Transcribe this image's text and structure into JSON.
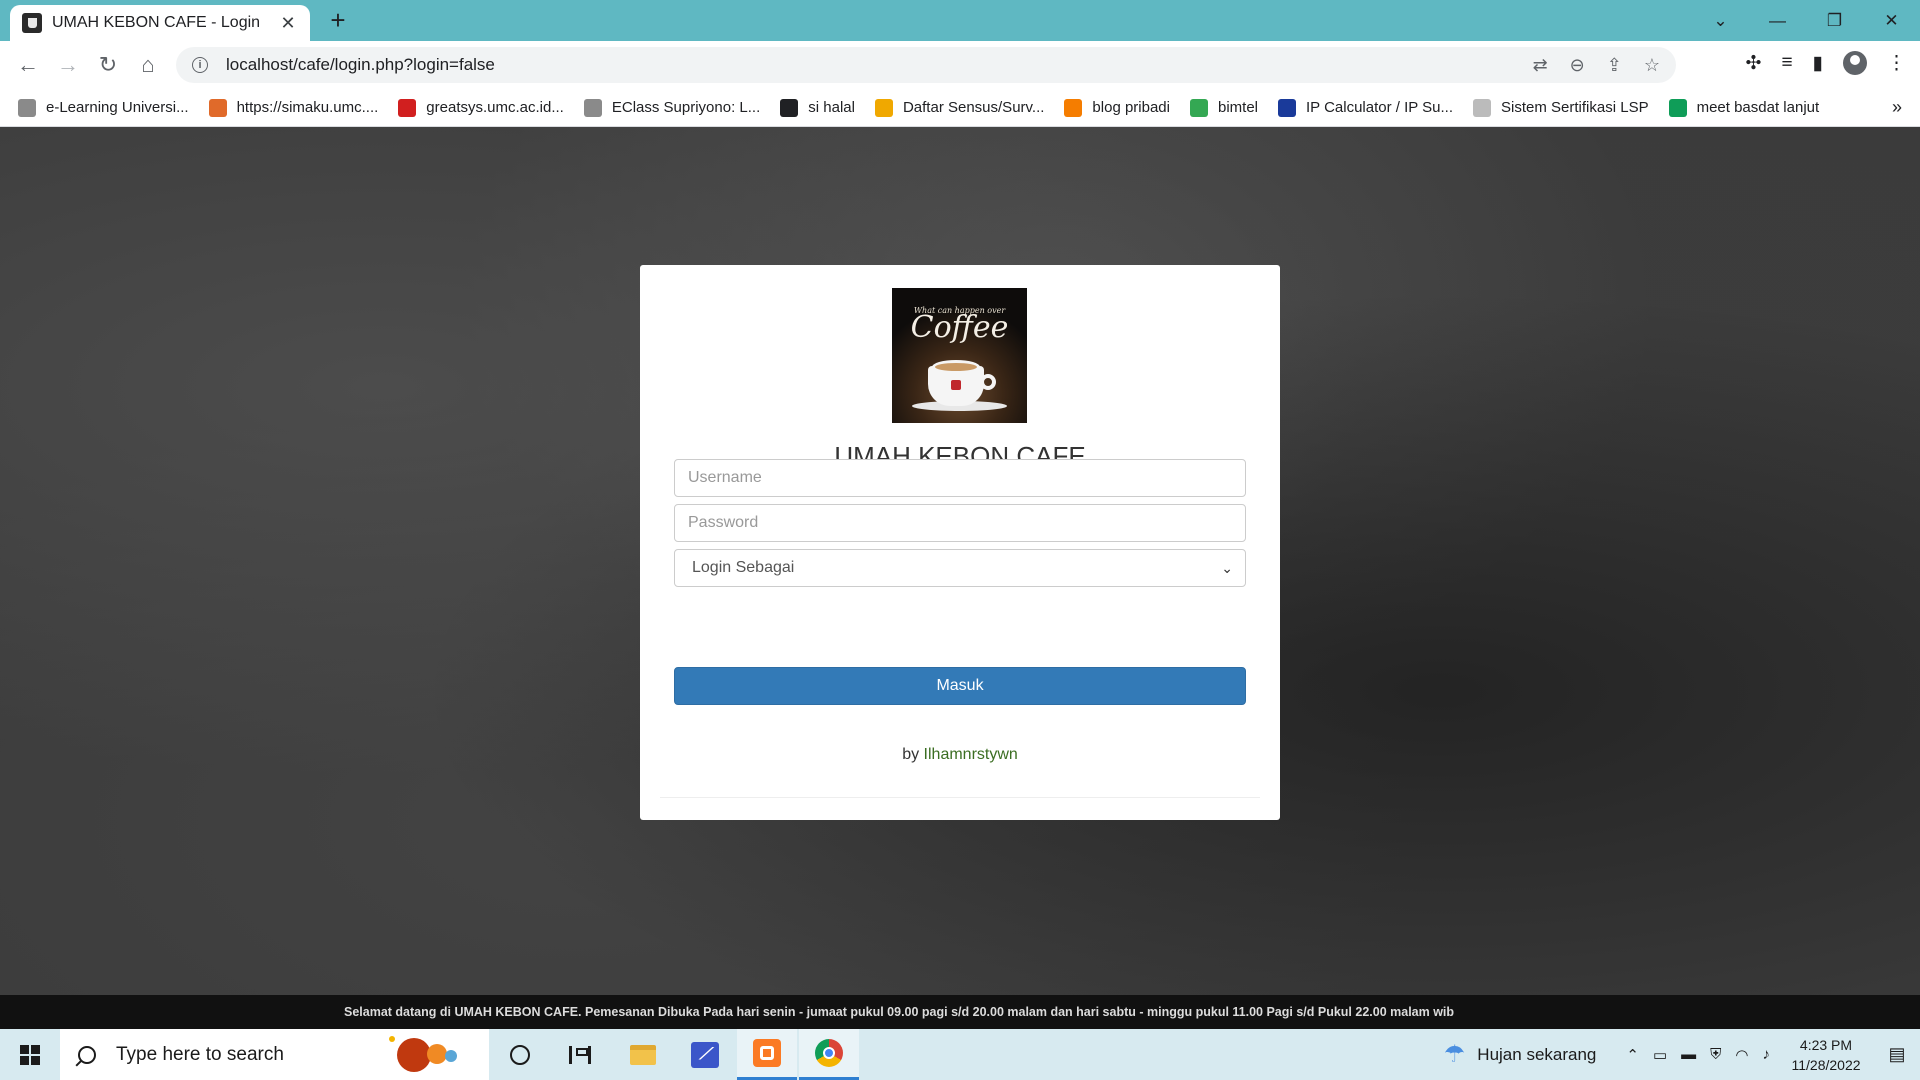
{
  "browser": {
    "tab_title": "UMAH KEBON CAFE - Login",
    "tab_close": "✕",
    "new_tab": "+",
    "url": "localhost/cafe/login.php?login=false",
    "bookmarks": [
      {
        "label": "e-Learning Universi...",
        "icon_color": "#8a8a8a",
        "icon": "elearning-icon"
      },
      {
        "label": "https://simaku.umc....",
        "icon_color": "#e06a2a",
        "icon": "simaku-icon"
      },
      {
        "label": "greatsys.umc.ac.id...",
        "icon_color": "#d11f1f",
        "icon": "greatsys-icon"
      },
      {
        "label": "EClass Supriyono: L...",
        "icon_color": "#8a8a8a",
        "icon": "eclass-icon"
      },
      {
        "label": "si halal",
        "icon_color": "#202124",
        "icon": "globe-icon"
      },
      {
        "label": "Daftar Sensus/Surv...",
        "icon_color": "#f0a800",
        "icon": "sensus-icon"
      },
      {
        "label": "blog pribadi",
        "icon_color": "#f57d00",
        "icon": "blogger-icon"
      },
      {
        "label": "bimtel",
        "icon_color": "#34a853",
        "icon": "drive-icon"
      },
      {
        "label": "IP Calculator / IP Su...",
        "icon_color": "#1a3a9a",
        "icon": "ip-icon"
      },
      {
        "label": "Sistem Sertifikasi LSP",
        "icon_color": "#bbbbbb",
        "icon": "lsp-icon"
      },
      {
        "label": "meet basdat lanjut",
        "icon_color": "#0f9d58",
        "icon": "meet-icon"
      }
    ],
    "bookmarks_more": "»"
  },
  "page": {
    "logo_sub": "What can happen over",
    "logo_word": "Coffee",
    "title": "UMAH KEBON CAFE",
    "username_placeholder": "Username",
    "password_placeholder": "Password",
    "role_select": "Login Sebagai",
    "submit_label": "Masuk",
    "credit_prefix": "by ",
    "credit_author": "Ilhamnrstywn",
    "marquee": "Selamat datang di UMAH KEBON CAFE. Pemesanan Dibuka Pada hari senin - jumaat pukul 09.00 pagi s/d 20.00 malam dan hari sabtu - minggu pukul 11.00 Pagi s/d Pukul 22.00 malam wib"
  },
  "taskbar": {
    "search_placeholder": "Type here to search",
    "weather": "Hujan sekarang",
    "time": "4:23 PM",
    "date": "11/28/2022"
  },
  "colors": {
    "tabbar": "#5fb8c2",
    "primary_button": "#337ab7",
    "credit_link": "#3b6e22"
  }
}
